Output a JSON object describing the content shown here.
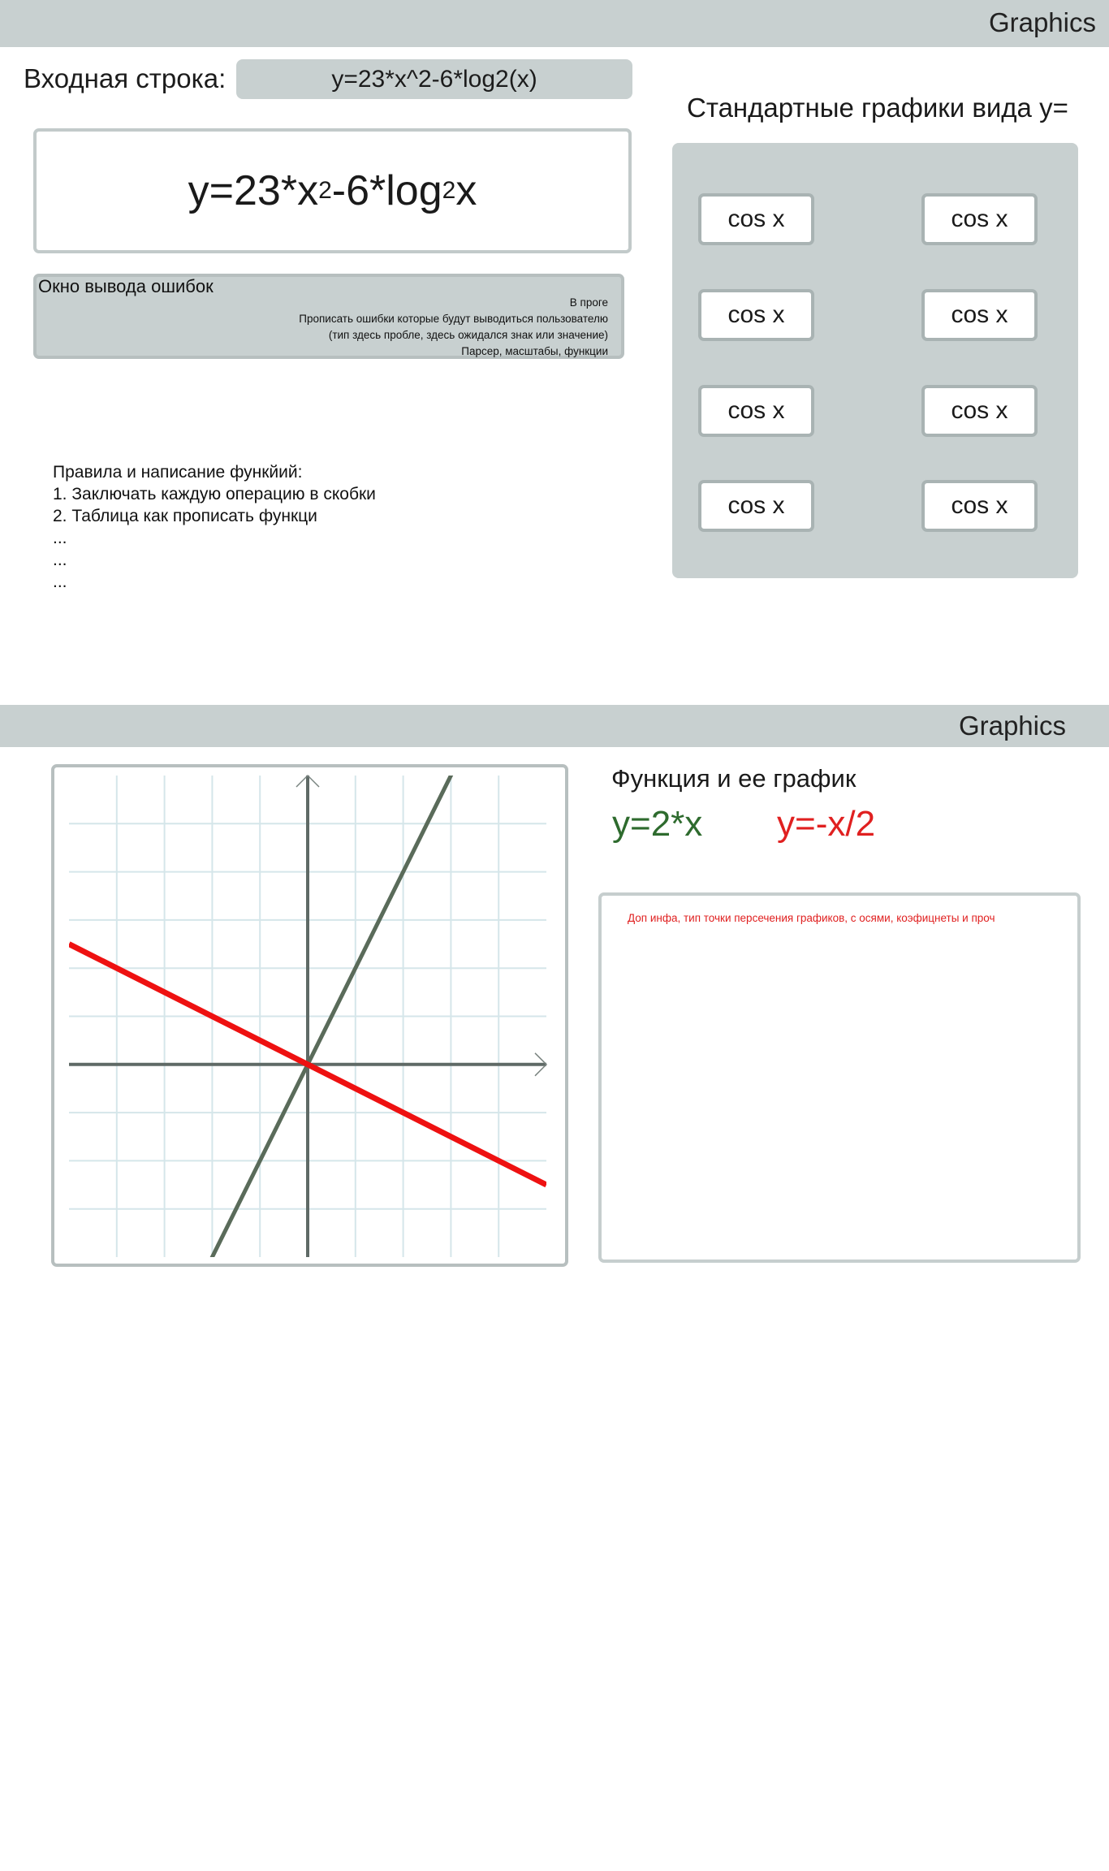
{
  "app": {
    "title": "Graphics"
  },
  "input": {
    "label": "Входная строка:",
    "value": "y=23*x^2-6*log2(x)"
  },
  "formula": {
    "main": "y=23*x",
    "power": "2",
    "middle": "-6*log",
    "base": "2",
    "arg": "x"
  },
  "errors": {
    "title": "Окно вывода ошибок",
    "lines": [
      "В проге",
      "Прописать ошибки которые будут выводиться пользователю",
      "(тип здесь пробле, здесь ожидался знак или значение)",
      "Парсер, масштабы, функции"
    ]
  },
  "rules": {
    "title": "Правила и написание функйий:",
    "items": [
      "1. Заключать каждую операцию в скобки",
      "2. Таблица как прописать функци",
      "...",
      "...",
      "..."
    ]
  },
  "standard": {
    "title": "Стандартные графики вида y=",
    "buttons": [
      "cos x",
      "cos x",
      "cos x",
      "cos x",
      "cos x",
      "cos x",
      "cos x",
      "cos x"
    ]
  },
  "graph_page": {
    "title": "Graphics",
    "heading": "Функция и ее график",
    "functions": [
      {
        "label": "y=2*x",
        "color": "#2e6b2e"
      },
      {
        "label": "y=-x/2",
        "color": "#e02020"
      }
    ],
    "info": "Доп инфа, тип точки персечения графиков, с осями, коэфицнеты и проч"
  },
  "chart_data": {
    "type": "line",
    "series": [
      {
        "name": "y=2*x",
        "slope": 2,
        "color": "#5a6b5a"
      },
      {
        "name": "y=-x/2",
        "slope": -0.5,
        "color": "#ee1111"
      }
    ],
    "xlim": [
      -5,
      5
    ],
    "ylim": [
      -4,
      6
    ],
    "grid": true,
    "grid_color": "#d5e6ea",
    "axis_color": "#5f6a66"
  },
  "colors": {
    "panel": "#c8d0d0",
    "border": "#b7bfbf",
    "accent_green": "#2e6b2e",
    "accent_red": "#e02020"
  }
}
